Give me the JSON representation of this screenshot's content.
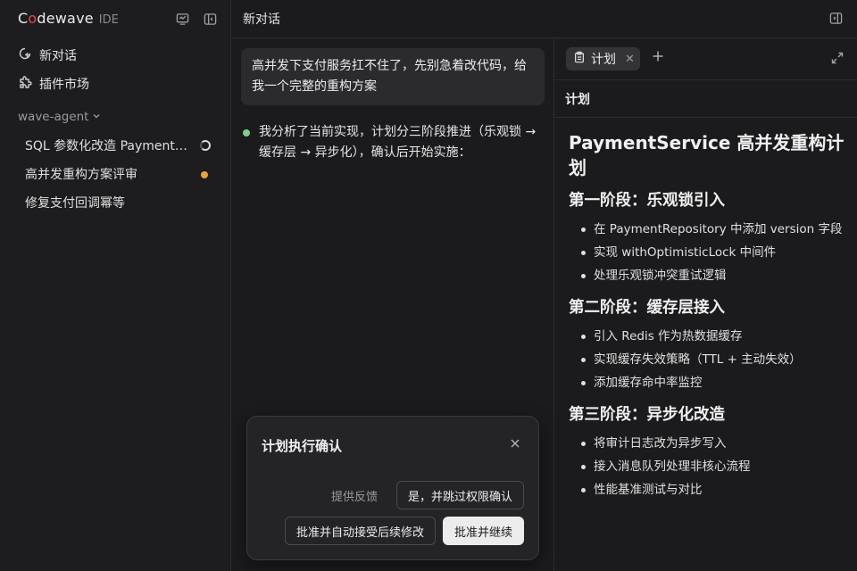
{
  "sidebar": {
    "brand_prefix": "C",
    "brand_o": "o",
    "brand_rest": "dewave",
    "brand_suffix": "IDE",
    "nav": [
      {
        "label": "新对话",
        "icon": "new-chat-icon"
      },
      {
        "label": "插件市场",
        "icon": "puzzle-icon"
      }
    ],
    "group_label": "wave-agent",
    "sessions": [
      {
        "label": "SQL 参数化改造 PaymentService",
        "status": "running"
      },
      {
        "label": "高并发重构方案评审",
        "status": "unread"
      },
      {
        "label": "修复支付回调幂等",
        "status": "none"
      }
    ]
  },
  "header": {
    "title": "新对话"
  },
  "chat": {
    "user_message": "高并发下支付服务扛不住了，先别急着改代码，给我一个完整的重构方案",
    "assistant_message": "我分析了当前实现，计划分三阶段推进（乐观锁 → 缓存层 → 异步化），确认后开始实施："
  },
  "panel": {
    "tab_label": "计划",
    "subheader": "计划",
    "doc": {
      "title": "PaymentService 高并发重构计划",
      "sections": [
        {
          "heading": "第一阶段：乐观锁引入",
          "items": [
            "在 PaymentRepository 中添加 version 字段",
            "实现 withOptimisticLock 中间件",
            "处理乐观锁冲突重试逻辑"
          ]
        },
        {
          "heading": "第二阶段：缓存层接入",
          "items": [
            "引入 Redis 作为热数据缓存",
            "实现缓存失效策略（TTL + 主动失效）",
            "添加缓存命中率监控"
          ]
        },
        {
          "heading": "第三阶段：异步化改造",
          "items": [
            "将审计日志改为异步写入",
            "接入消息队列处理非核心流程",
            "性能基准测试与对比"
          ]
        }
      ]
    }
  },
  "dialog": {
    "title": "计划执行确认",
    "feedback_label": "提供反馈",
    "btn_skip_permissions": "是，并跳过权限确认",
    "btn_auto_accept": "批准并自动接受后续修改",
    "btn_approve": "批准并继续"
  },
  "colors": {
    "accent_dot": "#7ecf8f",
    "unread_badge": "#e8a33b",
    "brand_o": "#e5484d"
  }
}
